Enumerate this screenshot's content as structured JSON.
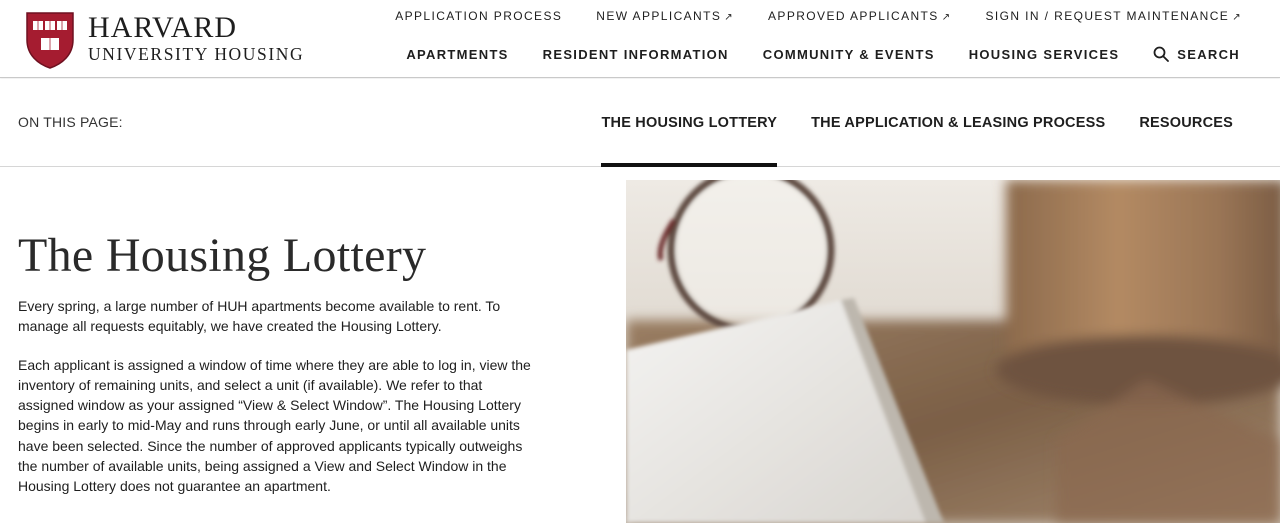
{
  "brand": {
    "name_top": "HARVARD",
    "name_bottom": "UNIVERSITY HOUSING",
    "shield_text_top": "VE RI",
    "shield_text_bottom": "TAS",
    "shield_color": "#a51c30"
  },
  "utility_nav": [
    {
      "label": "APPLICATION PROCESS",
      "external": ""
    },
    {
      "label": "NEW APPLICANTS",
      "external": "↗"
    },
    {
      "label": "APPROVED APPLICANTS",
      "external": "↗"
    },
    {
      "label": "SIGN IN / REQUEST MAINTENANCE",
      "external": "↗"
    }
  ],
  "main_nav": [
    {
      "label": "APARTMENTS"
    },
    {
      "label": "RESIDENT INFORMATION"
    },
    {
      "label": "COMMUNITY & EVENTS"
    },
    {
      "label": "HOUSING SERVICES"
    }
  ],
  "search": {
    "label": "SEARCH",
    "icon": "search-icon"
  },
  "on_this_page": {
    "label": "ON THIS PAGE:",
    "tabs": [
      {
        "label": "THE HOUSING LOTTERY",
        "active": true
      },
      {
        "label": "THE APPLICATION & LEASING PROCESS",
        "active": false
      },
      {
        "label": "RESOURCES",
        "active": false
      }
    ]
  },
  "content": {
    "title": "The Housing Lottery",
    "paragraphs": [
      "Every spring, a large number of HUH apartments become available to rent. To manage all requests equitably, we have created the Housing Lottery.",
      "Each applicant is assigned a window of time where they are able to log in, view the inventory of remaining units, and select a unit (if available). We refer to that assigned window as your assigned “View & Select Window”. The Housing Lottery begins in early to mid-May and runs through early June, or until all available units have been selected. Since the number of approved applicants typically outweighs the number of available units, being assigned a View and Select Window in the Housing Lottery does not guarantee an apartment."
    ]
  },
  "colors": {
    "text": "#1e1e1e",
    "active_underline": "#111111",
    "divider": "#d6d6d6"
  }
}
